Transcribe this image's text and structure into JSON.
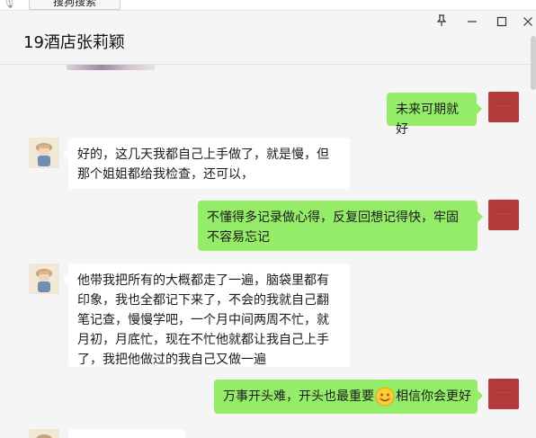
{
  "app": {
    "search_tab_label": "搜狗搜索",
    "chat_title": "19酒店张莉颖"
  },
  "window_controls": {
    "pin": "📌",
    "minimize": "—",
    "maximize": "☐",
    "close": "✕"
  },
  "messages": [
    {
      "side": "right",
      "text": "未来可期就好"
    },
    {
      "side": "left",
      "text": "好的，这几天我都自己上手做了，就是慢，但那个姐姐都给我检查，还可以，"
    },
    {
      "side": "right",
      "text": "不懂得多记录做心得，反复回想记得快，牢固不容易忘记"
    },
    {
      "side": "left",
      "text": "他带我把所有的大概都走了一遍，脑袋里都有印象，我也全都记下来了，不会的我就自己翻笔记查，慢慢学吧，一个月中间两周不忙，就月初，月底忙，现在不忙他就都让我自己上手了，我把他做过的我自己又做一遍"
    },
    {
      "side": "right",
      "text_before": "万事开头难，开头也最重要",
      "emoji": "smile-emoji",
      "text_after": "相信你会更好"
    }
  ],
  "colors": {
    "bubble_me": "#95ec69",
    "bubble_friend": "#ffffff",
    "window_bg": "#f5f5f5",
    "my_avatar": "#b33a3a"
  }
}
